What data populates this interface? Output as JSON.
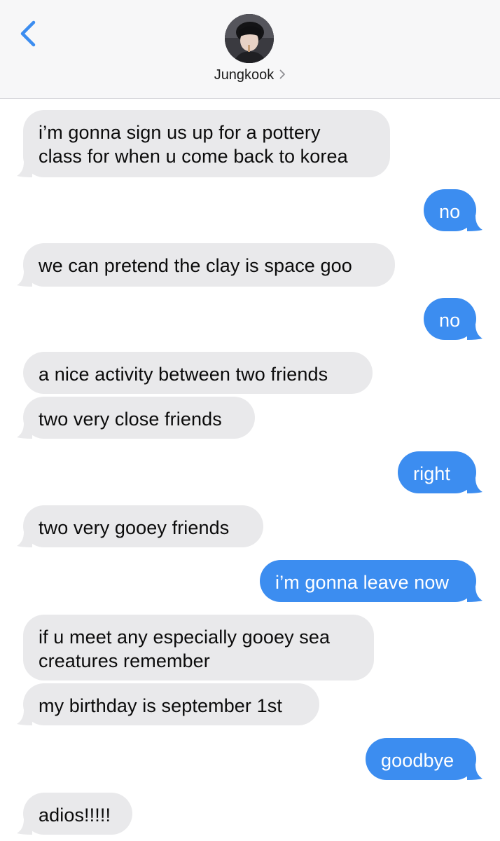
{
  "header": {
    "contact_name": "Jungkook",
    "back_icon": "chevron-left-icon",
    "detail_icon": "chevron-right-icon"
  },
  "colors": {
    "incoming_bubble": "#e9e9eb",
    "outgoing_bubble": "#3c8df0",
    "back_accent": "#3c8df0"
  },
  "messages": [
    {
      "from": "them",
      "text": [
        "i’m gonna sign us up for a pottery",
        "class for when u come back to korea"
      ]
    },
    {
      "from": "me",
      "text": [
        "no"
      ]
    },
    {
      "from": "them",
      "text": [
        "we can pretend the clay is space goo"
      ]
    },
    {
      "from": "me",
      "text": [
        "no"
      ]
    },
    {
      "from": "them",
      "text": [
        "a nice activity between two friends"
      ]
    },
    {
      "from": "them",
      "text": [
        "two very close friends"
      ]
    },
    {
      "from": "me",
      "text": [
        "right"
      ]
    },
    {
      "from": "them",
      "text": [
        "two very gooey friends"
      ]
    },
    {
      "from": "me",
      "text": [
        "i’m gonna leave now"
      ]
    },
    {
      "from": "them",
      "text": [
        "if u meet any especially gooey sea",
        "creatures remember"
      ]
    },
    {
      "from": "them",
      "text": [
        "my birthday is september 1st"
      ]
    },
    {
      "from": "me",
      "text": [
        "goodbye"
      ]
    },
    {
      "from": "them",
      "text": [
        "adios!!!!!"
      ]
    }
  ]
}
